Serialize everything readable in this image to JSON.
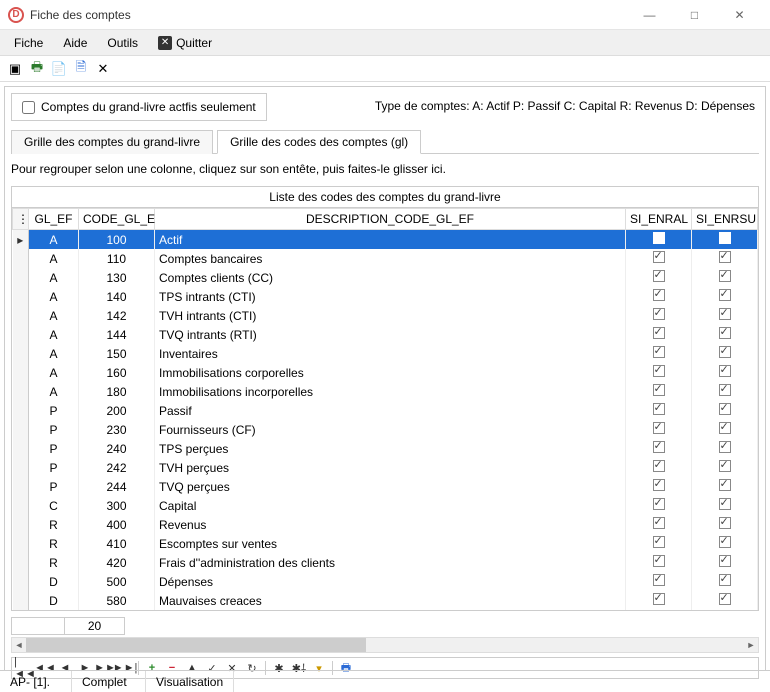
{
  "window": {
    "title": "Fiche des comptes"
  },
  "menu": {
    "fiche": "Fiche",
    "aide": "Aide",
    "outils": "Outils",
    "quitter": "Quitter"
  },
  "top": {
    "checkbox_label": "Comptes du grand-livre actfis seulement",
    "type_label": "Type de comptes:  A: Actif P: Passif C: Capital R: Revenus D: Dépenses"
  },
  "tabs": {
    "t1": "Grille des comptes du grand-livre",
    "t2": "Grille des codes des comptes (gl)"
  },
  "group_note": "Pour regrouper selon une colonne, cliquez sur son entête, puis faites-le glisser ici.",
  "list_title": "Liste des codes des comptes du grand-livre",
  "columns": {
    "gl": "GL_EF",
    "code": "CODE_GL_EF",
    "desc": "DESCRIPTION_CODE_GL_EF",
    "enral": "SI_ENRAL",
    "enrsu": "SI_ENRSU"
  },
  "rows": [
    {
      "gl": "A",
      "code": "100",
      "desc": "Actif",
      "enral": true,
      "enrsu": true,
      "selected": true
    },
    {
      "gl": "A",
      "code": "110",
      "desc": "Comptes bancaires",
      "enral": true,
      "enrsu": true
    },
    {
      "gl": "A",
      "code": "130",
      "desc": "Comptes clients (CC)",
      "enral": true,
      "enrsu": true
    },
    {
      "gl": "A",
      "code": "140",
      "desc": "TPS intrants (CTI)",
      "enral": true,
      "enrsu": true
    },
    {
      "gl": "A",
      "code": "142",
      "desc": "TVH intrants (CTI)",
      "enral": true,
      "enrsu": true
    },
    {
      "gl": "A",
      "code": "144",
      "desc": "TVQ intrants (RTI)",
      "enral": true,
      "enrsu": true
    },
    {
      "gl": "A",
      "code": "150",
      "desc": "Inventaires",
      "enral": true,
      "enrsu": true
    },
    {
      "gl": "A",
      "code": "160",
      "desc": "Immobilisations corporelles",
      "enral": true,
      "enrsu": true
    },
    {
      "gl": "A",
      "code": "180",
      "desc": "Immobilisations incorporelles",
      "enral": true,
      "enrsu": true
    },
    {
      "gl": "P",
      "code": "200",
      "desc": "Passif",
      "enral": true,
      "enrsu": true
    },
    {
      "gl": "P",
      "code": "230",
      "desc": "Fournisseurs (CF)",
      "enral": true,
      "enrsu": true
    },
    {
      "gl": "P",
      "code": "240",
      "desc": "TPS perçues",
      "enral": true,
      "enrsu": true
    },
    {
      "gl": "P",
      "code": "242",
      "desc": "TVH perçues",
      "enral": true,
      "enrsu": true
    },
    {
      "gl": "P",
      "code": "244",
      "desc": "TVQ perçues",
      "enral": true,
      "enrsu": true
    },
    {
      "gl": "C",
      "code": "300",
      "desc": "Capital",
      "enral": true,
      "enrsu": true
    },
    {
      "gl": "R",
      "code": "400",
      "desc": "Revenus",
      "enral": true,
      "enrsu": true
    },
    {
      "gl": "R",
      "code": "410",
      "desc": "Escomptes sur ventes",
      "enral": true,
      "enrsu": true
    },
    {
      "gl": "R",
      "code": "420",
      "desc": "Frais d''administration des clients",
      "enral": true,
      "enrsu": true
    },
    {
      "gl": "D",
      "code": "500",
      "desc": "Dépenses",
      "enral": true,
      "enrsu": true
    },
    {
      "gl": "D",
      "code": "580",
      "desc": "Mauvaises creaces",
      "enral": true,
      "enrsu": true
    }
  ],
  "count": "20",
  "status": {
    "s1": "AP- [1].",
    "s2": "Complet",
    "s3": "Visualisation"
  }
}
